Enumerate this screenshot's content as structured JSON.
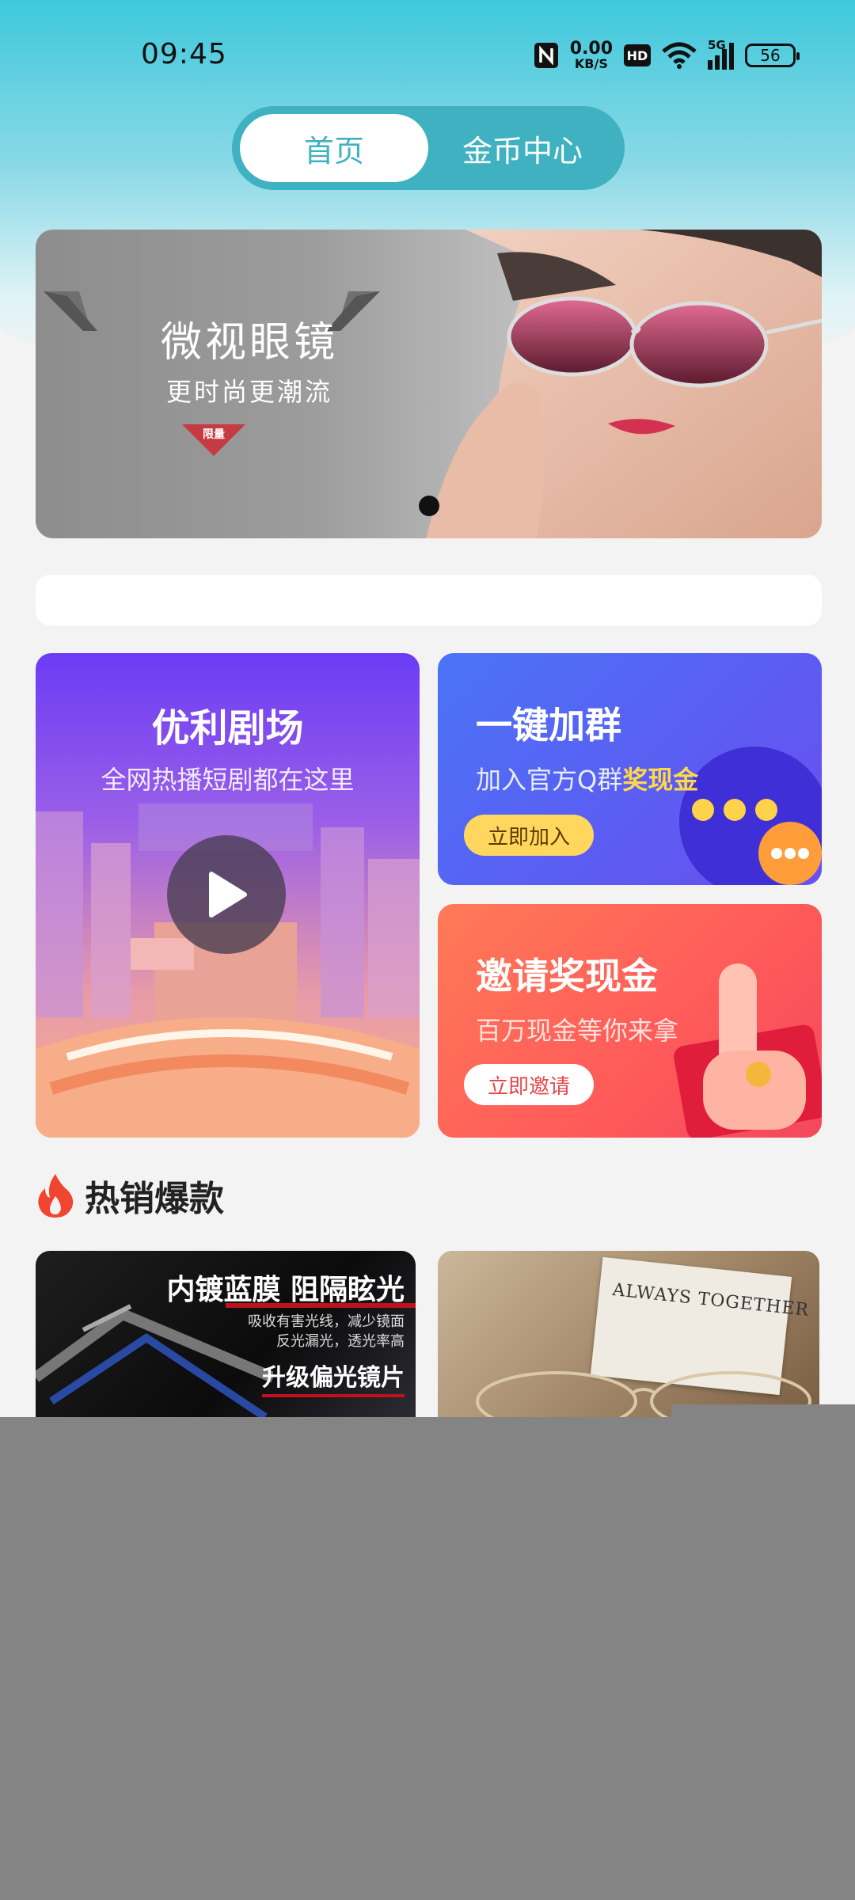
{
  "status_bar": {
    "time": "09:45",
    "net_speed_value": "0.00",
    "net_speed_unit": "KB/S",
    "hd_label": "HD",
    "signal_label": "5G",
    "battery": "56"
  },
  "tabs": [
    {
      "label": "首页",
      "active": true
    },
    {
      "label": "金币中心",
      "active": false
    }
  ],
  "banner": {
    "title": "微视眼镜",
    "subtitle": "更时尚更潮流",
    "tag": "限量",
    "active_slide_dot": 1
  },
  "cards": {
    "theater": {
      "title": "优利剧场",
      "subtitle": "全网热播短剧都在这里"
    },
    "group": {
      "title": "一键加群",
      "subtitle_prefix": "加入官方Q群",
      "subtitle_highlight": "奖现金",
      "button": "立即加入"
    },
    "invite": {
      "title": "邀请奖现金",
      "subtitle": "百万现金等你来拿",
      "button": "立即邀请"
    }
  },
  "hot_section": {
    "title": "热销爆款"
  },
  "products": [
    {
      "headline": "内镀蓝膜 阻隔眩光",
      "line1": "吸收有害光线，减少镜面",
      "line2": "反光漏光，透光率高",
      "tagline": "升级偏光镜片"
    },
    {
      "note_text": "ALWAYS TOGETHER"
    }
  ],
  "colors": {
    "accent_teal": "#3fb1c1",
    "group_button": "#ffd75e",
    "invite_red": "#ff5a5a",
    "highlight_yellow": "#ffd84a"
  }
}
